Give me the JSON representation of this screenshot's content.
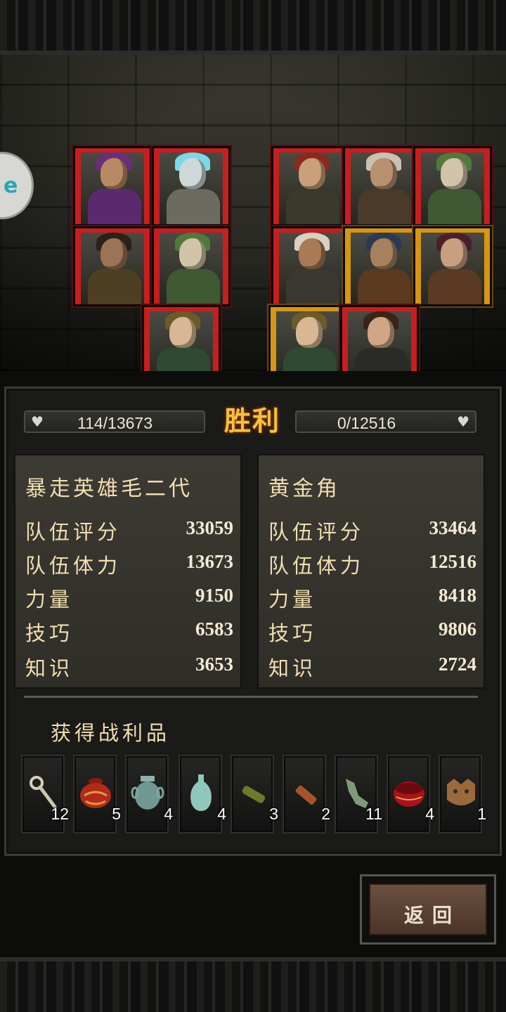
{
  "battle": {
    "result_label": "胜利",
    "player_hp": "114/13673",
    "enemy_hp": "0/12516"
  },
  "teams": {
    "left": {
      "name": "暴走英雄毛二代",
      "stats": [
        {
          "label": "队伍评分",
          "value": "33059"
        },
        {
          "label": "队伍体力",
          "value": "13673"
        },
        {
          "label": "力量",
          "value": "9150"
        },
        {
          "label": "技巧",
          "value": "6583"
        },
        {
          "label": "知识",
          "value": "3653"
        }
      ]
    },
    "right": {
      "name": "黄金角",
      "stats": [
        {
          "label": "队伍评分",
          "value": "33464"
        },
        {
          "label": "队伍体力",
          "value": "12516"
        },
        {
          "label": "力量",
          "value": "8418"
        },
        {
          "label": "技巧",
          "value": "9806"
        },
        {
          "label": "知识",
          "value": "2724"
        }
      ]
    }
  },
  "loot": {
    "title": "获得战利品",
    "items": [
      {
        "icon": "bone-key-icon",
        "count": "12"
      },
      {
        "icon": "red-lacquer-jar-icon",
        "count": "5"
      },
      {
        "icon": "bronze-vessel-icon",
        "count": "4"
      },
      {
        "icon": "celadon-vase-icon",
        "count": "4"
      },
      {
        "icon": "jade-cylinder-icon",
        "count": "3"
      },
      {
        "icon": "wooden-scroll-icon",
        "count": "2"
      },
      {
        "icon": "jade-pendant-icon",
        "count": "11"
      },
      {
        "icon": "red-lacquer-box-icon",
        "count": "4"
      },
      {
        "icon": "bronze-mask-icon",
        "count": "1"
      }
    ]
  },
  "buttons": {
    "back": "返回"
  }
}
